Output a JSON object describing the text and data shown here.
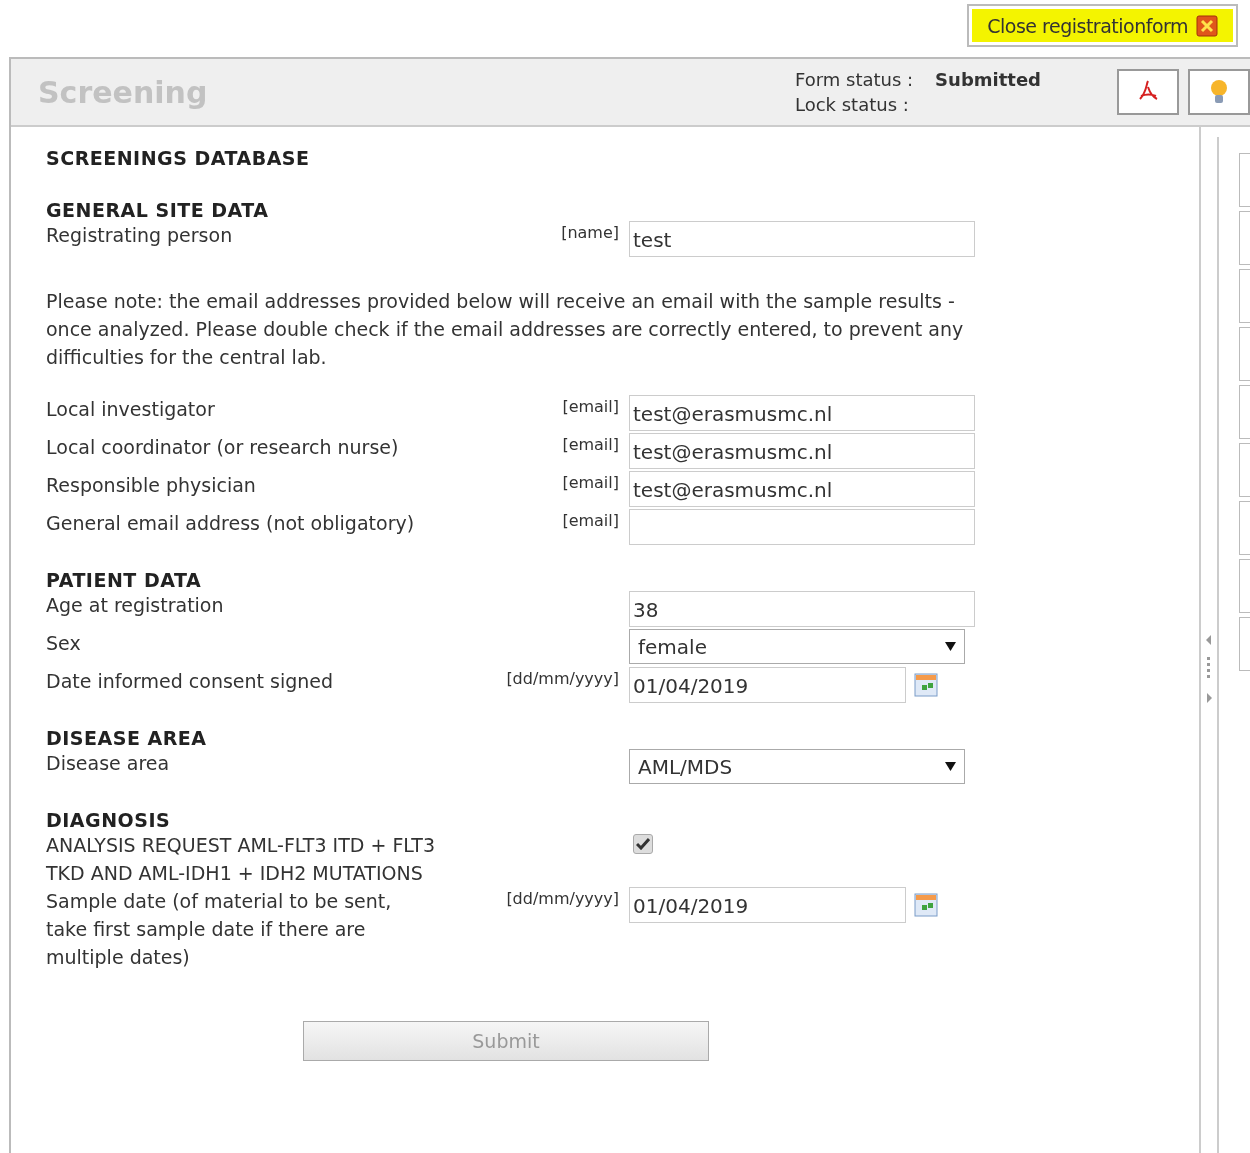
{
  "close_button": {
    "label": "Close registrationform",
    "highlighted": true
  },
  "header": {
    "title": "Screening",
    "form_status_label": "Form status :",
    "form_status": "Submitted",
    "lock_status_label": "Lock status :"
  },
  "form": {
    "title": "SCREENINGS DATABASE",
    "sections": [
      {
        "heading": "GENERAL SITE DATA",
        "items": [
          {
            "kind": "text",
            "label": "Registrating person",
            "tag": "[name]",
            "value": "test"
          },
          {
            "kind": "note",
            "text": "Please note: the email addresses provided below will receive an email with the sample results - once analyzed. Please double check if the email addresses are correctly entered, to prevent any difficulties for the central lab."
          },
          {
            "kind": "text",
            "label": "Local investigator",
            "tag": "[email]",
            "value": "test@erasmusmc.nl"
          },
          {
            "kind": "text",
            "label": "Local coordinator (or research nurse)",
            "tag": "[email]",
            "value": "test@erasmusmc.nl"
          },
          {
            "kind": "text",
            "label": "Responsible physician",
            "tag": "[email]",
            "value": "test@erasmusmc.nl"
          },
          {
            "kind": "text",
            "label": "General email address (not obligatory)",
            "tag": "[email]"
          }
        ]
      },
      {
        "heading": "PATIENT DATA",
        "items": [
          {
            "kind": "text",
            "label": "Age at registration",
            "value": "38"
          },
          {
            "kind": "select",
            "label": "Sex",
            "value": "female"
          },
          {
            "kind": "date",
            "label": "Date informed consent signed",
            "tag": "[dd/mm/yyyy]",
            "value": "01/04/2019"
          }
        ]
      },
      {
        "heading": "DISEASE AREA",
        "items": [
          {
            "kind": "select",
            "label": "Disease area",
            "value": "AML/MDS"
          }
        ]
      },
      {
        "heading": "DIAGNOSIS",
        "items": [
          {
            "kind": "checkbox",
            "label": "ANALYSIS REQUEST AML-FLT3 ITD + FLT3 TKD AND AML-IDH1 + IDH2 MUTATIONS",
            "checked": true
          },
          {
            "kind": "date",
            "label": "Sample date (of material to be sent, take first sample date if there are multiple dates)",
            "tag": "[dd/mm/yyyy]",
            "value": "01/04/2019"
          }
        ]
      }
    ],
    "submit": {
      "label": "Submit",
      "disabled": true
    }
  }
}
